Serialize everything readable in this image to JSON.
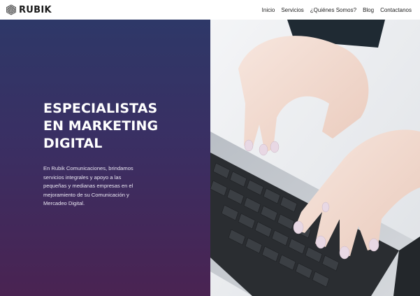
{
  "header": {
    "logo_text": "RUBIK",
    "nav": [
      {
        "label": "Inicio"
      },
      {
        "label": "Servicios"
      },
      {
        "label": "¿Quiénes Somos?"
      },
      {
        "label": "Blog"
      },
      {
        "label": "Contactanos"
      }
    ]
  },
  "hero": {
    "title": "ESPECIALISTAS\nEN MARKETING\nDIGITAL",
    "description": "En Rubik Comunicaciones, brindamos\nservicios integrales y apoyo a las\npequeñas y medianas empresas en el\nmejoramiento de su Comunicación y\nMercadeo Digital.",
    "image_icon": "laptop-typing-photo"
  },
  "colors": {
    "hero_gradient_top": "#2e3868",
    "hero_gradient_bottom": "#4a2352",
    "title_text": "#ffffff",
    "nav_text": "#222222"
  }
}
